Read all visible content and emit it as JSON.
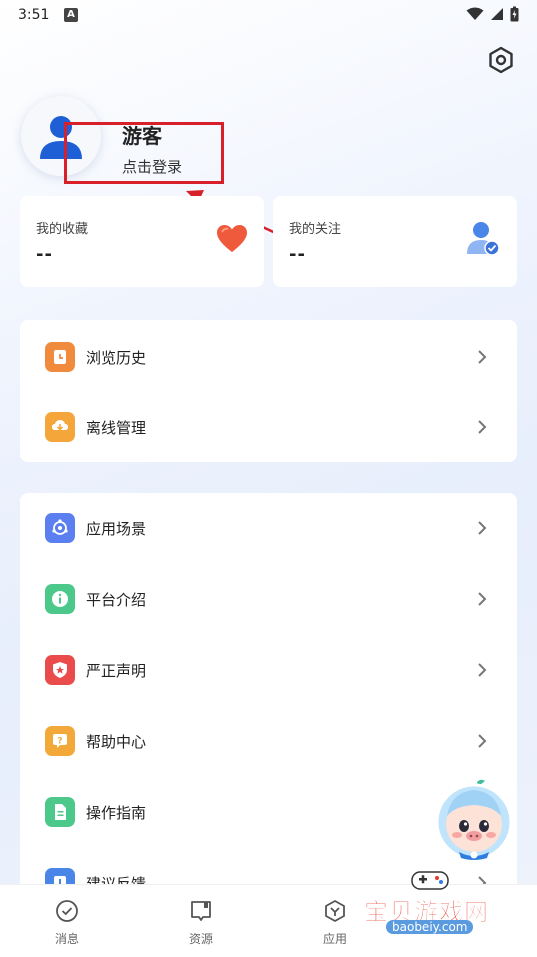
{
  "status_bar": {
    "time": "3:51",
    "notification_letter": "A"
  },
  "profile": {
    "name": "游客",
    "login_prompt": "点击登录"
  },
  "stats": [
    {
      "title": "我的收藏",
      "value": "--",
      "icon": "heart-icon"
    },
    {
      "title": "我的关注",
      "value": "--",
      "icon": "user-check-icon"
    }
  ],
  "menu_group_1": [
    {
      "label": "浏览历史",
      "icon": "history-icon",
      "color": "#f08a3c"
    },
    {
      "label": "离线管理",
      "icon": "download-icon",
      "color": "#f5a63b"
    }
  ],
  "menu_group_2": [
    {
      "label": "应用场景",
      "icon": "scene-icon",
      "color": "#5b7ff0"
    },
    {
      "label": "平台介绍",
      "icon": "info-icon",
      "color": "#4cc98a"
    },
    {
      "label": "严正声明",
      "icon": "statement-icon",
      "color": "#ea4b4b"
    },
    {
      "label": "帮助中心",
      "icon": "help-icon",
      "color": "#f3a93a"
    },
    {
      "label": "操作指南",
      "icon": "guide-icon",
      "color": "#4cc98a"
    },
    {
      "label": "建议反馈",
      "icon": "feedback-icon",
      "color": "#4a86e8"
    }
  ],
  "tabbar": [
    {
      "label": "消息",
      "icon": "message-icon"
    },
    {
      "label": "资源",
      "icon": "resource-icon"
    },
    {
      "label": "应用",
      "icon": "app-icon"
    }
  ],
  "watermark": {
    "text": "宝贝游戏网",
    "url": "baobeiy.com"
  }
}
